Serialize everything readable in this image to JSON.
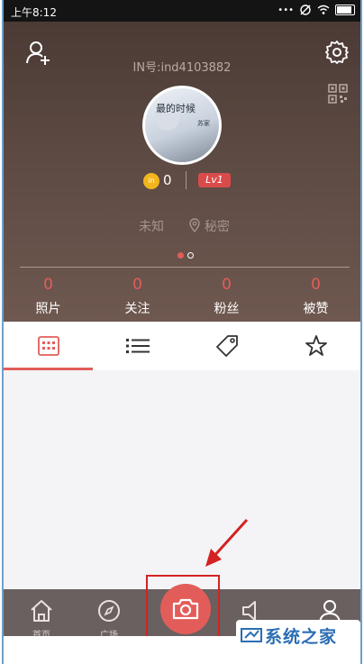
{
  "statusbar": {
    "time": "上午8:12"
  },
  "profile": {
    "in_id": "IN号:ind4103882",
    "coins": "0",
    "coin_icon_text": "in",
    "level": "Lv1",
    "gender": "未知",
    "location": "秘密",
    "avatar_text_1": "最的时候",
    "avatar_text_2": "苏家"
  },
  "stats": [
    {
      "value": "0",
      "label": "照片"
    },
    {
      "value": "0",
      "label": "关注"
    },
    {
      "value": "0",
      "label": "粉丝"
    },
    {
      "value": "0",
      "label": "被赞"
    }
  ],
  "tabs": [
    {
      "icon": "grid-icon",
      "active": true
    },
    {
      "icon": "list-icon",
      "active": false
    },
    {
      "icon": "tag-icon",
      "active": false
    },
    {
      "icon": "star-icon",
      "active": false
    }
  ],
  "bottom_nav": {
    "home_label": "首页",
    "square_label": "广场"
  },
  "watermark": {
    "text": "系统之家"
  },
  "colors": {
    "accent": "#e25d59",
    "header": "#5d4a43",
    "nav": "#6a6060",
    "highlight": "#d42222"
  }
}
